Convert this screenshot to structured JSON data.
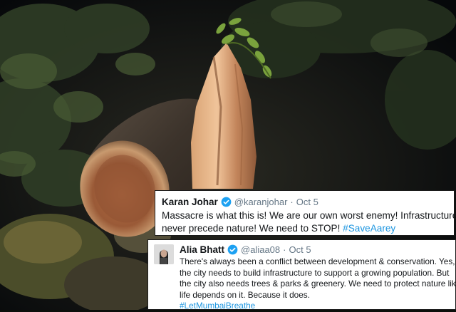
{
  "photo": {
    "subject": "felled-tree-trunk-at-night"
  },
  "tweets": [
    {
      "name": "Karan Johar",
      "handle": "@karanjohar",
      "separator": "·",
      "date": "Oct 5",
      "lines": [
        "Massacre is what this is! We are our own worst enemy! Infrastructure can",
        "never precede nature! We need to STOP! "
      ],
      "hashtag": "#SaveAarey"
    },
    {
      "name": "Alia Bhatt",
      "handle": "@aliaa08",
      "separator": "·",
      "date": "Oct 5",
      "lines": [
        "There's always been a conflict between development & conservation. Yes,",
        "the city needs to build infrastructure to support a growing population. But",
        "the city also needs trees & parks & greenery. We need to protect nature like",
        "life depends on it. Because it does."
      ],
      "hashtag": "#LetMumbaiBreathe"
    }
  ],
  "colors": {
    "accent": "#1b95e0",
    "verified": "#1da1f2",
    "muted": "#657786",
    "text": "#14171a"
  }
}
